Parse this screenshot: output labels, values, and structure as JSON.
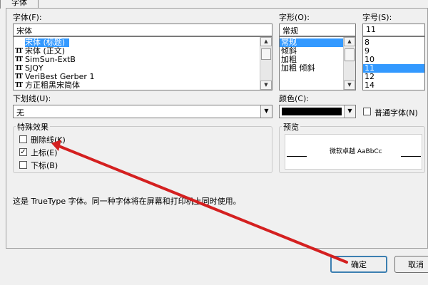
{
  "tab": {
    "label": "字体"
  },
  "font": {
    "label": "字体(F):",
    "value": "宋体",
    "items": [
      {
        "label": "宋体 (标题)",
        "selected": true
      },
      {
        "label": "宋体 (正文)",
        "selected": false
      },
      {
        "label": "SimSun-ExtB",
        "selected": false
      },
      {
        "label": "SJQY",
        "selected": false
      },
      {
        "label": "VeriBest Gerber 1",
        "selected": false
      },
      {
        "label": "方正粗黑宋简体",
        "selected": false
      }
    ]
  },
  "style": {
    "label": "字形(O):",
    "value": "常规",
    "items": [
      {
        "label": "常规",
        "selected": true
      },
      {
        "label": "倾斜",
        "selected": false
      },
      {
        "label": "加粗",
        "selected": false
      },
      {
        "label": "加粗 倾斜",
        "selected": false
      }
    ]
  },
  "size": {
    "label": "字号(S):",
    "value": "11",
    "items": [
      {
        "label": "8",
        "selected": false
      },
      {
        "label": "9",
        "selected": false
      },
      {
        "label": "10",
        "selected": false
      },
      {
        "label": "11",
        "selected": true
      },
      {
        "label": "12",
        "selected": false
      },
      {
        "label": "14",
        "selected": false
      }
    ]
  },
  "underline": {
    "label": "下划线(U):",
    "value": "无"
  },
  "color": {
    "label": "颜色(C):",
    "value": "#000000",
    "normal_font_label": "普通字体(N)"
  },
  "effects": {
    "title": "特殊效果",
    "strikethrough": {
      "label": "删除线(K)",
      "checked": false
    },
    "superscript": {
      "label": "上标(E)",
      "checked": true
    },
    "subscript": {
      "label": "下标(B)",
      "checked": false
    }
  },
  "preview": {
    "title": "预览",
    "sample": "微软卓越 AaBbCc"
  },
  "info_text": "这是 TrueType 字体。同一种字体将在屏幕和打印机上同时使用。",
  "buttons": {
    "ok": "确定",
    "cancel": "取消"
  },
  "colors": {
    "selection": "#3399ff",
    "annotation_arrow": "#d42020"
  },
  "icons": {
    "font_type": "truetype-icon",
    "check": "checkmark-icon",
    "dropdown": "chevron-down-icon"
  }
}
